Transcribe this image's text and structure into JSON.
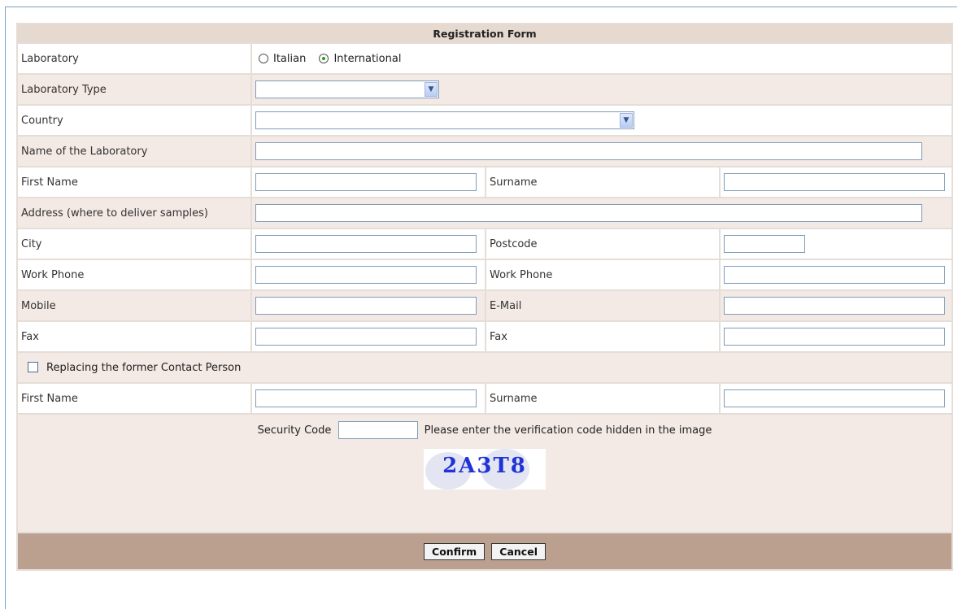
{
  "form": {
    "title": "Registration Form",
    "laboratory": {
      "label": "Laboratory",
      "options": [
        "Italian",
        "International"
      ],
      "selected": "International"
    },
    "laboratory_type": {
      "label": "Laboratory Type",
      "value": ""
    },
    "country": {
      "label": "Country",
      "value": ""
    },
    "lab_name": {
      "label": "Name of the Laboratory",
      "value": ""
    },
    "first_name": {
      "label": "First Name",
      "value": ""
    },
    "surname": {
      "label": "Surname",
      "value": ""
    },
    "address": {
      "label": "Address (where to deliver samples)",
      "value": ""
    },
    "city": {
      "label": "City",
      "value": ""
    },
    "postcode": {
      "label": "Postcode",
      "value": ""
    },
    "work_phone_1": {
      "label": "Work Phone",
      "value": ""
    },
    "work_phone_2": {
      "label": "Work Phone",
      "value": ""
    },
    "mobile": {
      "label": "Mobile",
      "value": ""
    },
    "email": {
      "label": "E-Mail",
      "value": ""
    },
    "fax_1": {
      "label": "Fax",
      "value": ""
    },
    "fax_2": {
      "label": "Fax",
      "value": ""
    },
    "replace_contact": {
      "label": "Replacing the former Contact Person",
      "checked": false
    },
    "former_first_name": {
      "label": "First Name",
      "value": ""
    },
    "former_surname": {
      "label": "Surname",
      "value": ""
    },
    "security": {
      "label": "Security Code",
      "value": "",
      "hint": "Please enter the verification code hidden in the image",
      "captcha_text": "2A3T8"
    },
    "buttons": {
      "confirm": "Confirm",
      "cancel": "Cancel"
    }
  },
  "colors": {
    "header_bg": "#e6d9d0",
    "row_pink": "#f3e9e5",
    "footer_bg": "#bba090",
    "captcha_text": "#1f33d6",
    "radio_dot": "#21a121"
  }
}
